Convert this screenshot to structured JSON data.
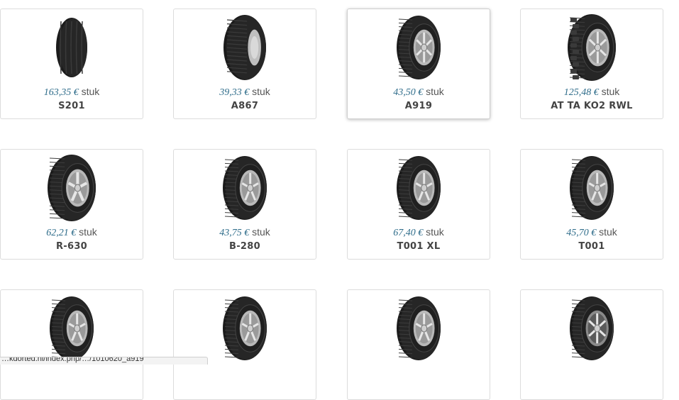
{
  "products": [
    {
      "price": "163,35 €",
      "unit": "stuk",
      "name": "S201",
      "tire_icon": "truck-tire-icon",
      "style": "truck"
    },
    {
      "price": "39,33 €",
      "unit": "stuk",
      "name": "A867",
      "tire_icon": "van-tire-icon",
      "style": "van"
    },
    {
      "price": "43,50 €",
      "unit": "stuk",
      "name": "A919",
      "tire_icon": "suv-tire-icon",
      "style": "suv"
    },
    {
      "price": "125,48 €",
      "unit": "stuk",
      "name": "AT TA KO2 RWL",
      "tire_icon": "all-terrain-tire-icon",
      "style": "at"
    },
    {
      "price": "62,21 €",
      "unit": "stuk",
      "name": "R-630",
      "tire_icon": "van-tire-icon",
      "style": "vanrim"
    },
    {
      "price": "43,75 €",
      "unit": "stuk",
      "name": "B-280",
      "tire_icon": "car-tire-icon",
      "style": "car"
    },
    {
      "price": "67,40 €",
      "unit": "stuk",
      "name": "T001 XL",
      "tire_icon": "car-tire-icon",
      "style": "car"
    },
    {
      "price": "45,70 €",
      "unit": "stuk",
      "name": "T001",
      "tire_icon": "car-tire-icon",
      "style": "car"
    },
    {
      "price": "",
      "unit": "",
      "name": "",
      "tire_icon": "car-tire-icon",
      "style": "car"
    },
    {
      "price": "",
      "unit": "",
      "name": "",
      "tire_icon": "car-tire-icon",
      "style": "car"
    },
    {
      "price": "",
      "unit": "",
      "name": "",
      "tire_icon": "car-tire-icon",
      "style": "car"
    },
    {
      "price": "",
      "unit": "",
      "name": "",
      "tire_icon": "sport-tire-icon",
      "style": "sport"
    }
  ],
  "status_bar": {
    "url": "…kdorted.nl/index.php/…/1010620_a919"
  },
  "colors": {
    "price": "#2e6c8a",
    "card_border": "#dcdcdc"
  }
}
